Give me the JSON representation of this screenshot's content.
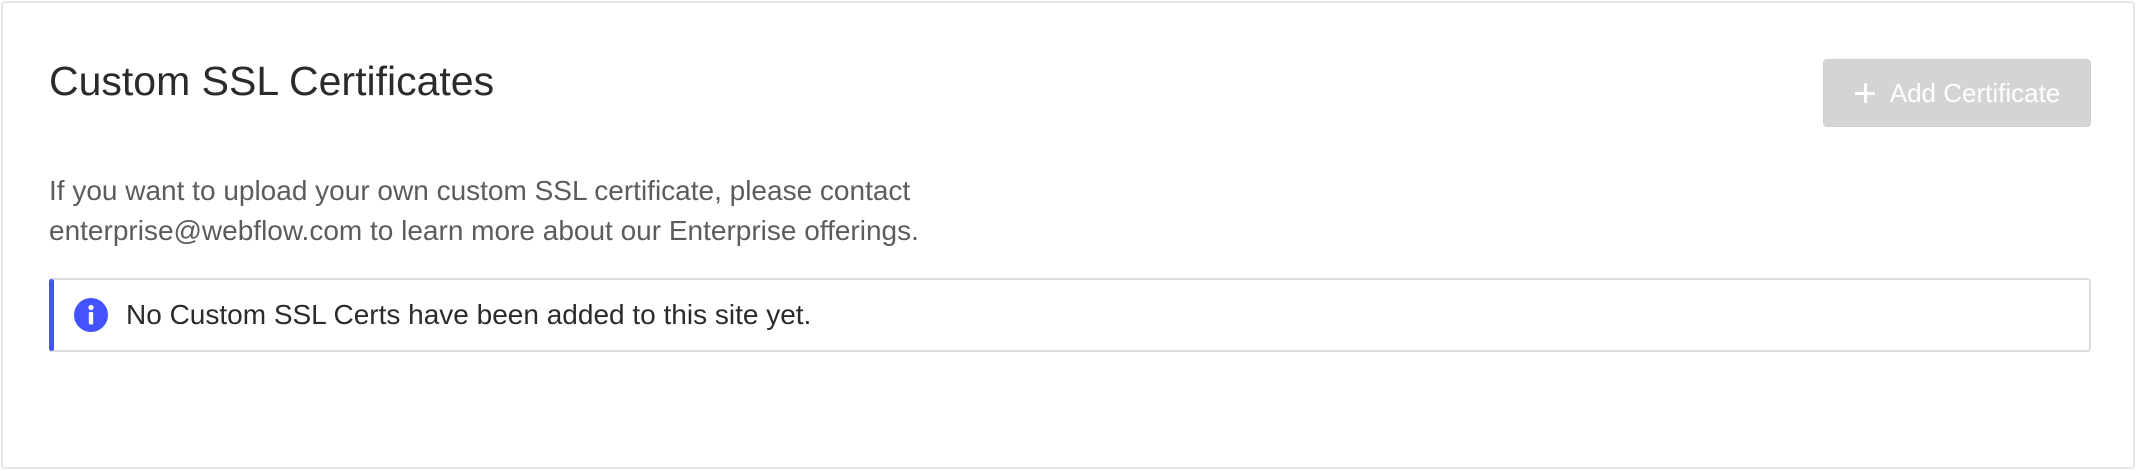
{
  "section": {
    "title": "Custom SSL Certificates",
    "add_button_label": "Add Certificate",
    "description_line1": "If you want to upload your own custom SSL certificate, please contact",
    "description_line2": "enterprise@webflow.com to learn more about our Enterprise offerings.",
    "notice_text": "No Custom SSL Certs have been added to this site yet."
  },
  "icons": {
    "add_icon": "plus-icon",
    "notice_icon": "info-icon"
  },
  "colors": {
    "accent": "#4353ff",
    "button_disabled_bg": "#d4d4d4",
    "title_text": "#2b2b2b",
    "body_text": "#5c5c5c",
    "border": "#dcdcdc"
  }
}
